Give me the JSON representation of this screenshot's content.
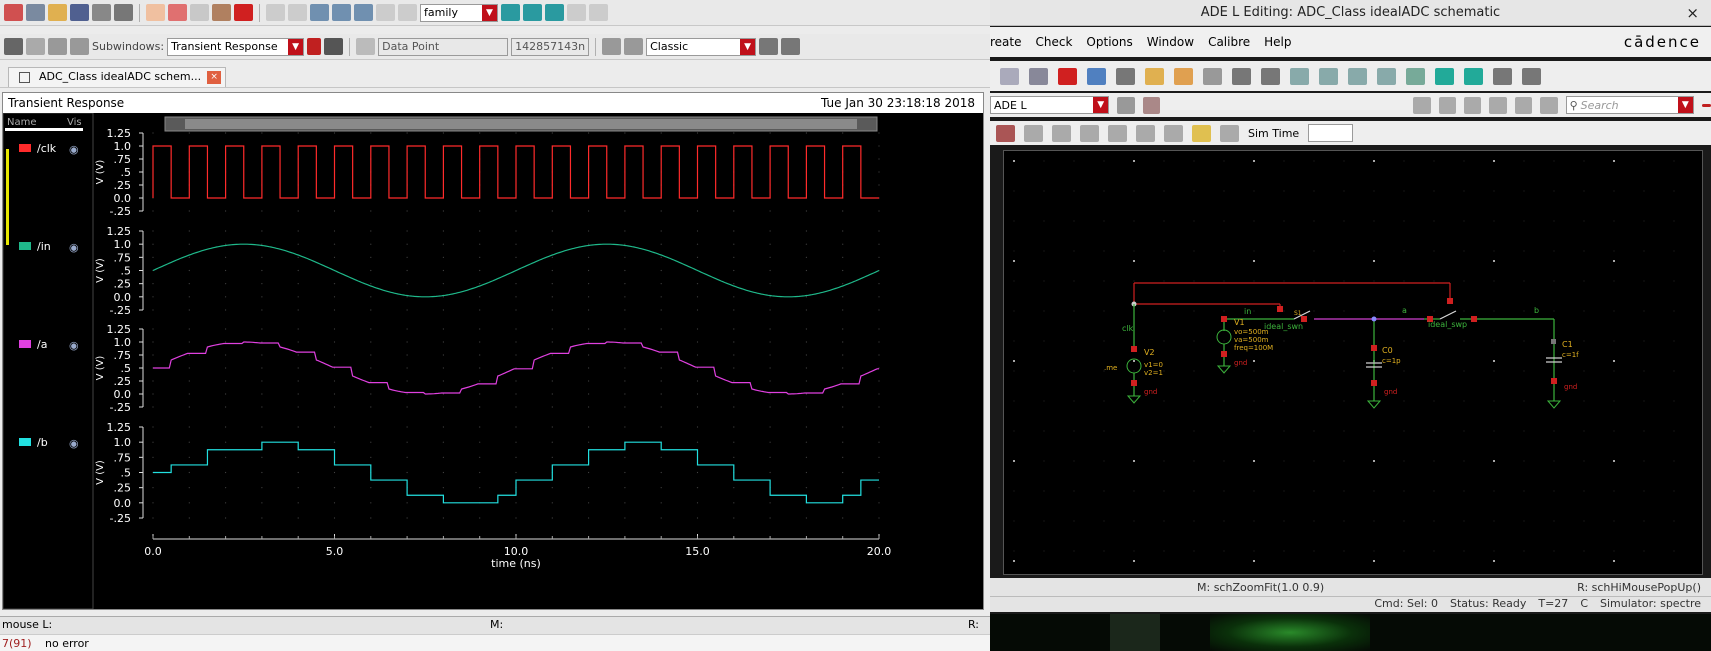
{
  "left_window": {
    "toolbar1": {
      "family_value": "family"
    },
    "toolbar2": {
      "subwindows_label": "Subwindows:",
      "subwindow_value": "Transient Response",
      "data_point_value": "Data Point",
      "value_readout": "142857143n",
      "style_value": "Classic"
    },
    "tab": {
      "label": "ADC_Class idealADC schem..."
    },
    "plot": {
      "title": "Transient Response",
      "date": "Tue Jan 30 23:18:18 2018",
      "col_name": "Name",
      "col_vis": "Vis",
      "xlabel": "time (ns)",
      "ylabel": "V (V)"
    },
    "status": {
      "mouse_label": "mouse L:",
      "mid_label": "M:",
      "right_label": "R:",
      "line_no": "7(91)",
      "message": "no error"
    }
  },
  "chart_data": {
    "type": "line",
    "xlabel": "time (ns)",
    "xlim": [
      0,
      20
    ],
    "x_ticks": [
      "0.0",
      "5.0",
      "10.0",
      "15.0",
      "20.0"
    ],
    "y_ticks": [
      "1.25",
      "1.0",
      ".75",
      ".5",
      ".25",
      "0.0",
      "-.25"
    ],
    "ylim": [
      -0.25,
      1.25
    ],
    "ylabel": "V (V)",
    "series": [
      {
        "name": "/clk",
        "color": "#ff2b2b",
        "kind": "clock",
        "period_ns": 1.0,
        "high": 1.0,
        "low": 0.0
      },
      {
        "name": "/in",
        "color": "#1fb88a",
        "kind": "sine",
        "offset": 0.5,
        "amplitude": 0.5,
        "freq_ghz": 0.1,
        "phase_deg": 0
      },
      {
        "name": "/a",
        "color": "#e040e0",
        "kind": "sampled-sine"
      },
      {
        "name": "/b",
        "color": "#22e0e0",
        "kind": "quantized",
        "x": [
          0,
          0.5,
          1,
          1.5,
          2,
          2.5,
          3,
          3.5,
          4,
          4.5,
          5,
          5.5,
          6,
          6.5,
          7,
          7.5,
          8,
          8.5,
          9,
          9.5,
          10,
          10.5,
          11,
          11.5,
          12,
          12.5,
          13,
          13.5,
          14,
          14.5,
          15,
          15.5,
          16,
          16.5,
          17,
          17.5,
          18,
          18.5,
          19,
          19.5,
          20
        ],
        "y": [
          0.5,
          0.625,
          0.625,
          0.875,
          0.875,
          0.875,
          1,
          1,
          0.875,
          0.875,
          0.625,
          0.625,
          0.375,
          0.375,
          0.125,
          0.125,
          0,
          0,
          0,
          0.125,
          0.375,
          0.375,
          0.625,
          0.625,
          0.875,
          0.875,
          1,
          1,
          0.875,
          0.875,
          0.625,
          0.625,
          0.375,
          0.375,
          0.125,
          0.125,
          0,
          0,
          0.125,
          0.375,
          0.375
        ]
      }
    ]
  },
  "right_window": {
    "title": "ADE L Editing: ADC_Class idealADC schematic",
    "menu": [
      "reate",
      "Check",
      "Options",
      "Window",
      "Calibre",
      "Help"
    ],
    "brand": "cādence",
    "mode_combo": "ADE L",
    "search_placeholder": "Search",
    "sim_time_label": "Sim Time",
    "schematic": {
      "net_clk": "clk",
      "net_in": "in",
      "net_a": "a",
      "net_b": "b",
      "vclk_name": "V2",
      "vclk_params": [
        "v1=0",
        "v2=1"
      ],
      "vin_name": "V1",
      "vin_params": [
        "vo=500m",
        "va=500m",
        "freq=100M"
      ],
      "sw1_label": "ideal_swn",
      "sw2_label": "ideal_swp",
      "c0_name": "C0",
      "c0_value": "c=1p",
      "c1_name": "C1",
      "c1_value": "c=1f",
      "gnd": "gnd"
    },
    "status": {
      "mouse_m": "M: schZoomFit(1.0 0.9)",
      "mouse_r": "R: schHiMousePopUp()",
      "cmd": "Cmd: Sel: 0",
      "state": "Status: Ready",
      "t": "T=27",
      "c": "C",
      "simulator": "Simulator: spectre"
    }
  },
  "colors": {
    "clk": "#ff2b2b",
    "in": "#1fb88a",
    "a": "#e040e0",
    "b": "#22e0e0",
    "wire": "#3cb43c",
    "accent_red": "#c0101a"
  }
}
